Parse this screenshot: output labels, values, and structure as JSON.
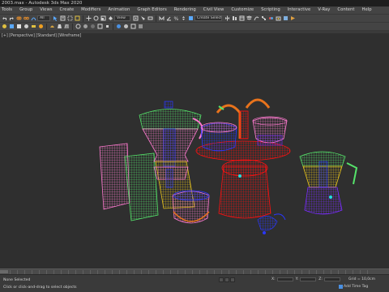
{
  "window": {
    "title": "2003.max - Autodesk 3ds Max 2020"
  },
  "menu": [
    "Tools",
    "Group",
    "Views",
    "Create",
    "Modifiers",
    "Animation",
    "Graph Editors",
    "Rendering",
    "Civil View",
    "Customize",
    "Scripting",
    "Interactive",
    "V-Ray",
    "Content",
    "Help"
  ],
  "toolbar": {
    "filter_value": "All",
    "view_value": "View",
    "selection_set": "Create Selection Se"
  },
  "viewport": {
    "label": "[+] [Perspective] [Standard] [Wireframe]"
  },
  "status": {
    "selection": "None Selected",
    "prompt": "Click or click-and-drag to select objects",
    "x_label": "X:",
    "y_label": "Y:",
    "z_label": "Z:",
    "grid": "Grid = 10,0cm",
    "add_time_tag": "Add Time Tag"
  },
  "colors": {
    "viewport_bg": "#2f2f2f",
    "accent": "#4a90e2",
    "wire_pink": "#ff7ad0",
    "wire_green": "#55e36a",
    "wire_blue": "#2a37ff",
    "wire_red": "#ff1010",
    "wire_yellow": "#e9c51c",
    "wire_orange": "#e8731c",
    "wire_purple": "#7a2cff"
  }
}
